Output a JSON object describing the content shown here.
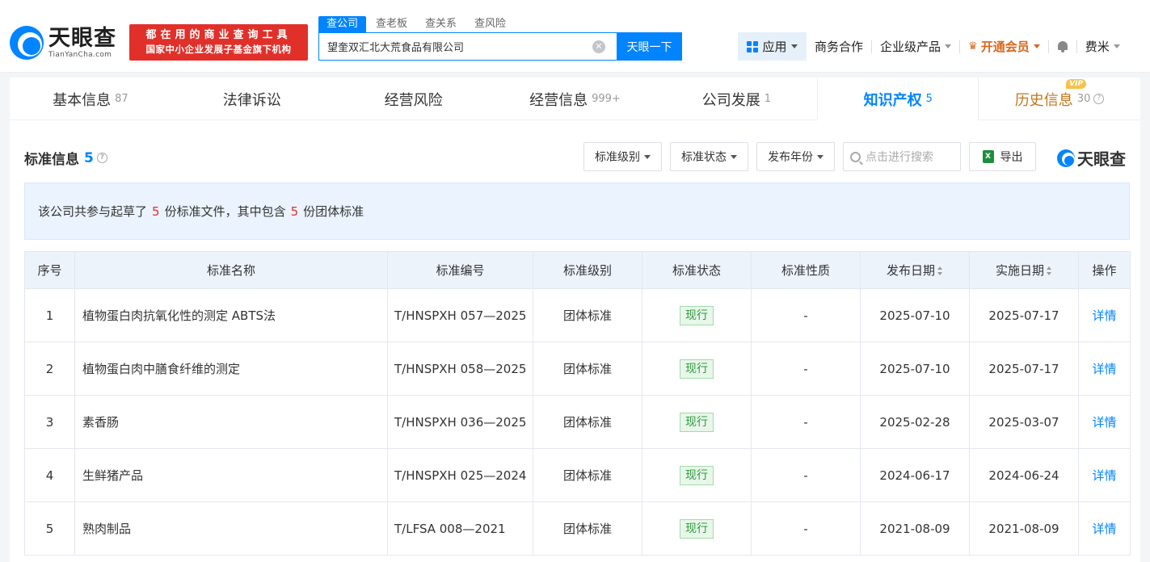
{
  "header": {
    "logo_cn": "天眼查",
    "logo_en": "TianYanCha.com",
    "slogan_line1": "都在用的商业查询工具",
    "slogan_line2": "国家中小企业发展子基金旗下机构",
    "search_tabs": [
      "查公司",
      "查老板",
      "查关系",
      "查风险"
    ],
    "search_value": "望奎双汇北大荒食品有限公司",
    "search_button": "天眼一下",
    "nav": {
      "app": "应用",
      "business": "商务合作",
      "enterprise": "企业级产品",
      "vip": "开通会员",
      "user": "费米"
    }
  },
  "tabs": [
    {
      "label": "基本信息",
      "count": "87"
    },
    {
      "label": "法律诉讼",
      "count": ""
    },
    {
      "label": "经营风险",
      "count": ""
    },
    {
      "label": "经营信息",
      "count": "999+"
    },
    {
      "label": "公司发展",
      "count": "1"
    },
    {
      "label": "知识产权",
      "count": "5"
    },
    {
      "label": "历史信息",
      "count": "30",
      "badge": "VIP"
    }
  ],
  "section": {
    "title": "标准信息",
    "count": "5",
    "filters": [
      "标准级别",
      "标准状态",
      "发布年份"
    ],
    "search_placeholder": "点击进行搜索",
    "export": "导出",
    "brand": "天眼查"
  },
  "summary": {
    "part1": "该公司共参与起草了",
    "n1": "5",
    "part2": "份标准文件，其中包含",
    "n2": "5",
    "part3": "份团体标准"
  },
  "table": {
    "headers": [
      "序号",
      "标准名称",
      "标准编号",
      "标准级别",
      "标准状态",
      "标准性质",
      "发布日期",
      "实施日期",
      "操作"
    ],
    "rows": [
      {
        "idx": "1",
        "name": "植物蛋白肉抗氧化性的测定 ABTS法",
        "code": "T/HNSPXH 057—2025",
        "level": "团体标准",
        "status": "现行",
        "nature": "-",
        "pub": "2025-07-10",
        "impl": "2025-07-17",
        "op": "详情"
      },
      {
        "idx": "2",
        "name": "植物蛋白肉中膳食纤维的测定",
        "code": "T/HNSPXH 058—2025",
        "level": "团体标准",
        "status": "现行",
        "nature": "-",
        "pub": "2025-07-10",
        "impl": "2025-07-17",
        "op": "详情"
      },
      {
        "idx": "3",
        "name": "素香肠",
        "code": "T/HNSPXH 036—2025",
        "level": "团体标准",
        "status": "现行",
        "nature": "-",
        "pub": "2025-02-28",
        "impl": "2025-03-07",
        "op": "详情"
      },
      {
        "idx": "4",
        "name": "生鲜猪产品",
        "code": "T/HNSPXH 025—2024",
        "level": "团体标准",
        "status": "现行",
        "nature": "-",
        "pub": "2024-06-17",
        "impl": "2024-06-24",
        "op": "详情"
      },
      {
        "idx": "5",
        "name": "熟肉制品",
        "code": "T/LFSA 008—2021",
        "level": "团体标准",
        "status": "现行",
        "nature": "-",
        "pub": "2021-08-09",
        "impl": "2021-08-09",
        "op": "详情"
      }
    ]
  },
  "colors": {
    "accent": "#0084ff",
    "brand_red": "#e1302a",
    "status_green": "#2f9a3e",
    "vip": "#d9661a"
  }
}
